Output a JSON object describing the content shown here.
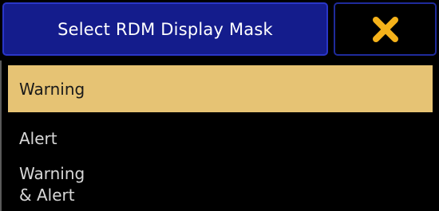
{
  "dialog": {
    "title": "Select RDM Display Mask",
    "close_icon": "close-icon",
    "accent_color": "#141c8c",
    "selected_color": "#e6c374"
  },
  "options": [
    {
      "label": "Warning",
      "selected": true
    },
    {
      "label": "Alert",
      "selected": false
    },
    {
      "label_line1": "Warning",
      "label_line2": "& Alert",
      "selected": false
    }
  ]
}
